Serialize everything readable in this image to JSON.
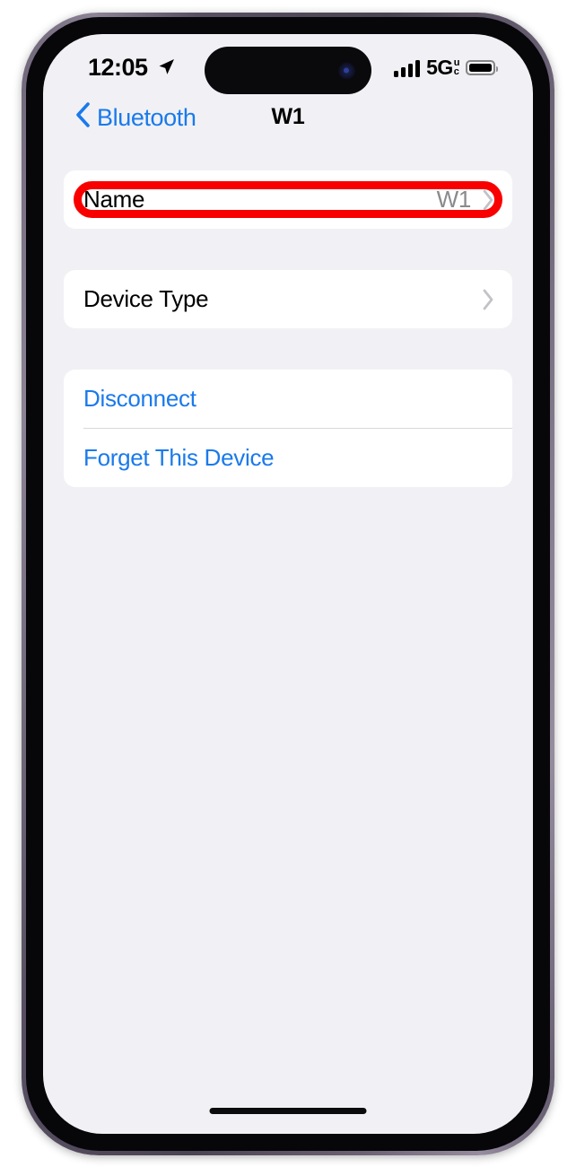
{
  "status_bar": {
    "time": "12:05",
    "location_icon": "location-arrow-icon",
    "signal_icon": "cellular-bars-icon",
    "network": "5G",
    "network_sup": "u",
    "network_sub": "c",
    "battery_icon": "battery-icon"
  },
  "nav": {
    "back_label": "Bluetooth",
    "back_icon": "chevron-left-icon",
    "title": "W1"
  },
  "groups": [
    {
      "id": "name-group",
      "highlighted": true,
      "rows": [
        {
          "label": "Name",
          "value": "W1",
          "type": "disclosure",
          "chevron": "chevron-right-icon"
        }
      ]
    },
    {
      "id": "device-type-group",
      "highlighted": false,
      "rows": [
        {
          "label": "Device Type",
          "value": "",
          "type": "disclosure",
          "chevron": "chevron-right-icon"
        }
      ]
    },
    {
      "id": "actions-group",
      "highlighted": false,
      "rows": [
        {
          "label": "Disconnect",
          "value": "",
          "type": "action"
        },
        {
          "label": "Forget This Device",
          "value": "",
          "type": "action"
        }
      ]
    }
  ],
  "annotation": {
    "color": "#f80000",
    "target": "Name"
  },
  "colors": {
    "accent_blue": "#1a7aeb",
    "screen_background": "#f1f1f5",
    "card_background": "#ffffff",
    "value_gray": "#8a8a8e",
    "annotation_red": "#f80000"
  },
  "home_indicator": "home-indicator"
}
